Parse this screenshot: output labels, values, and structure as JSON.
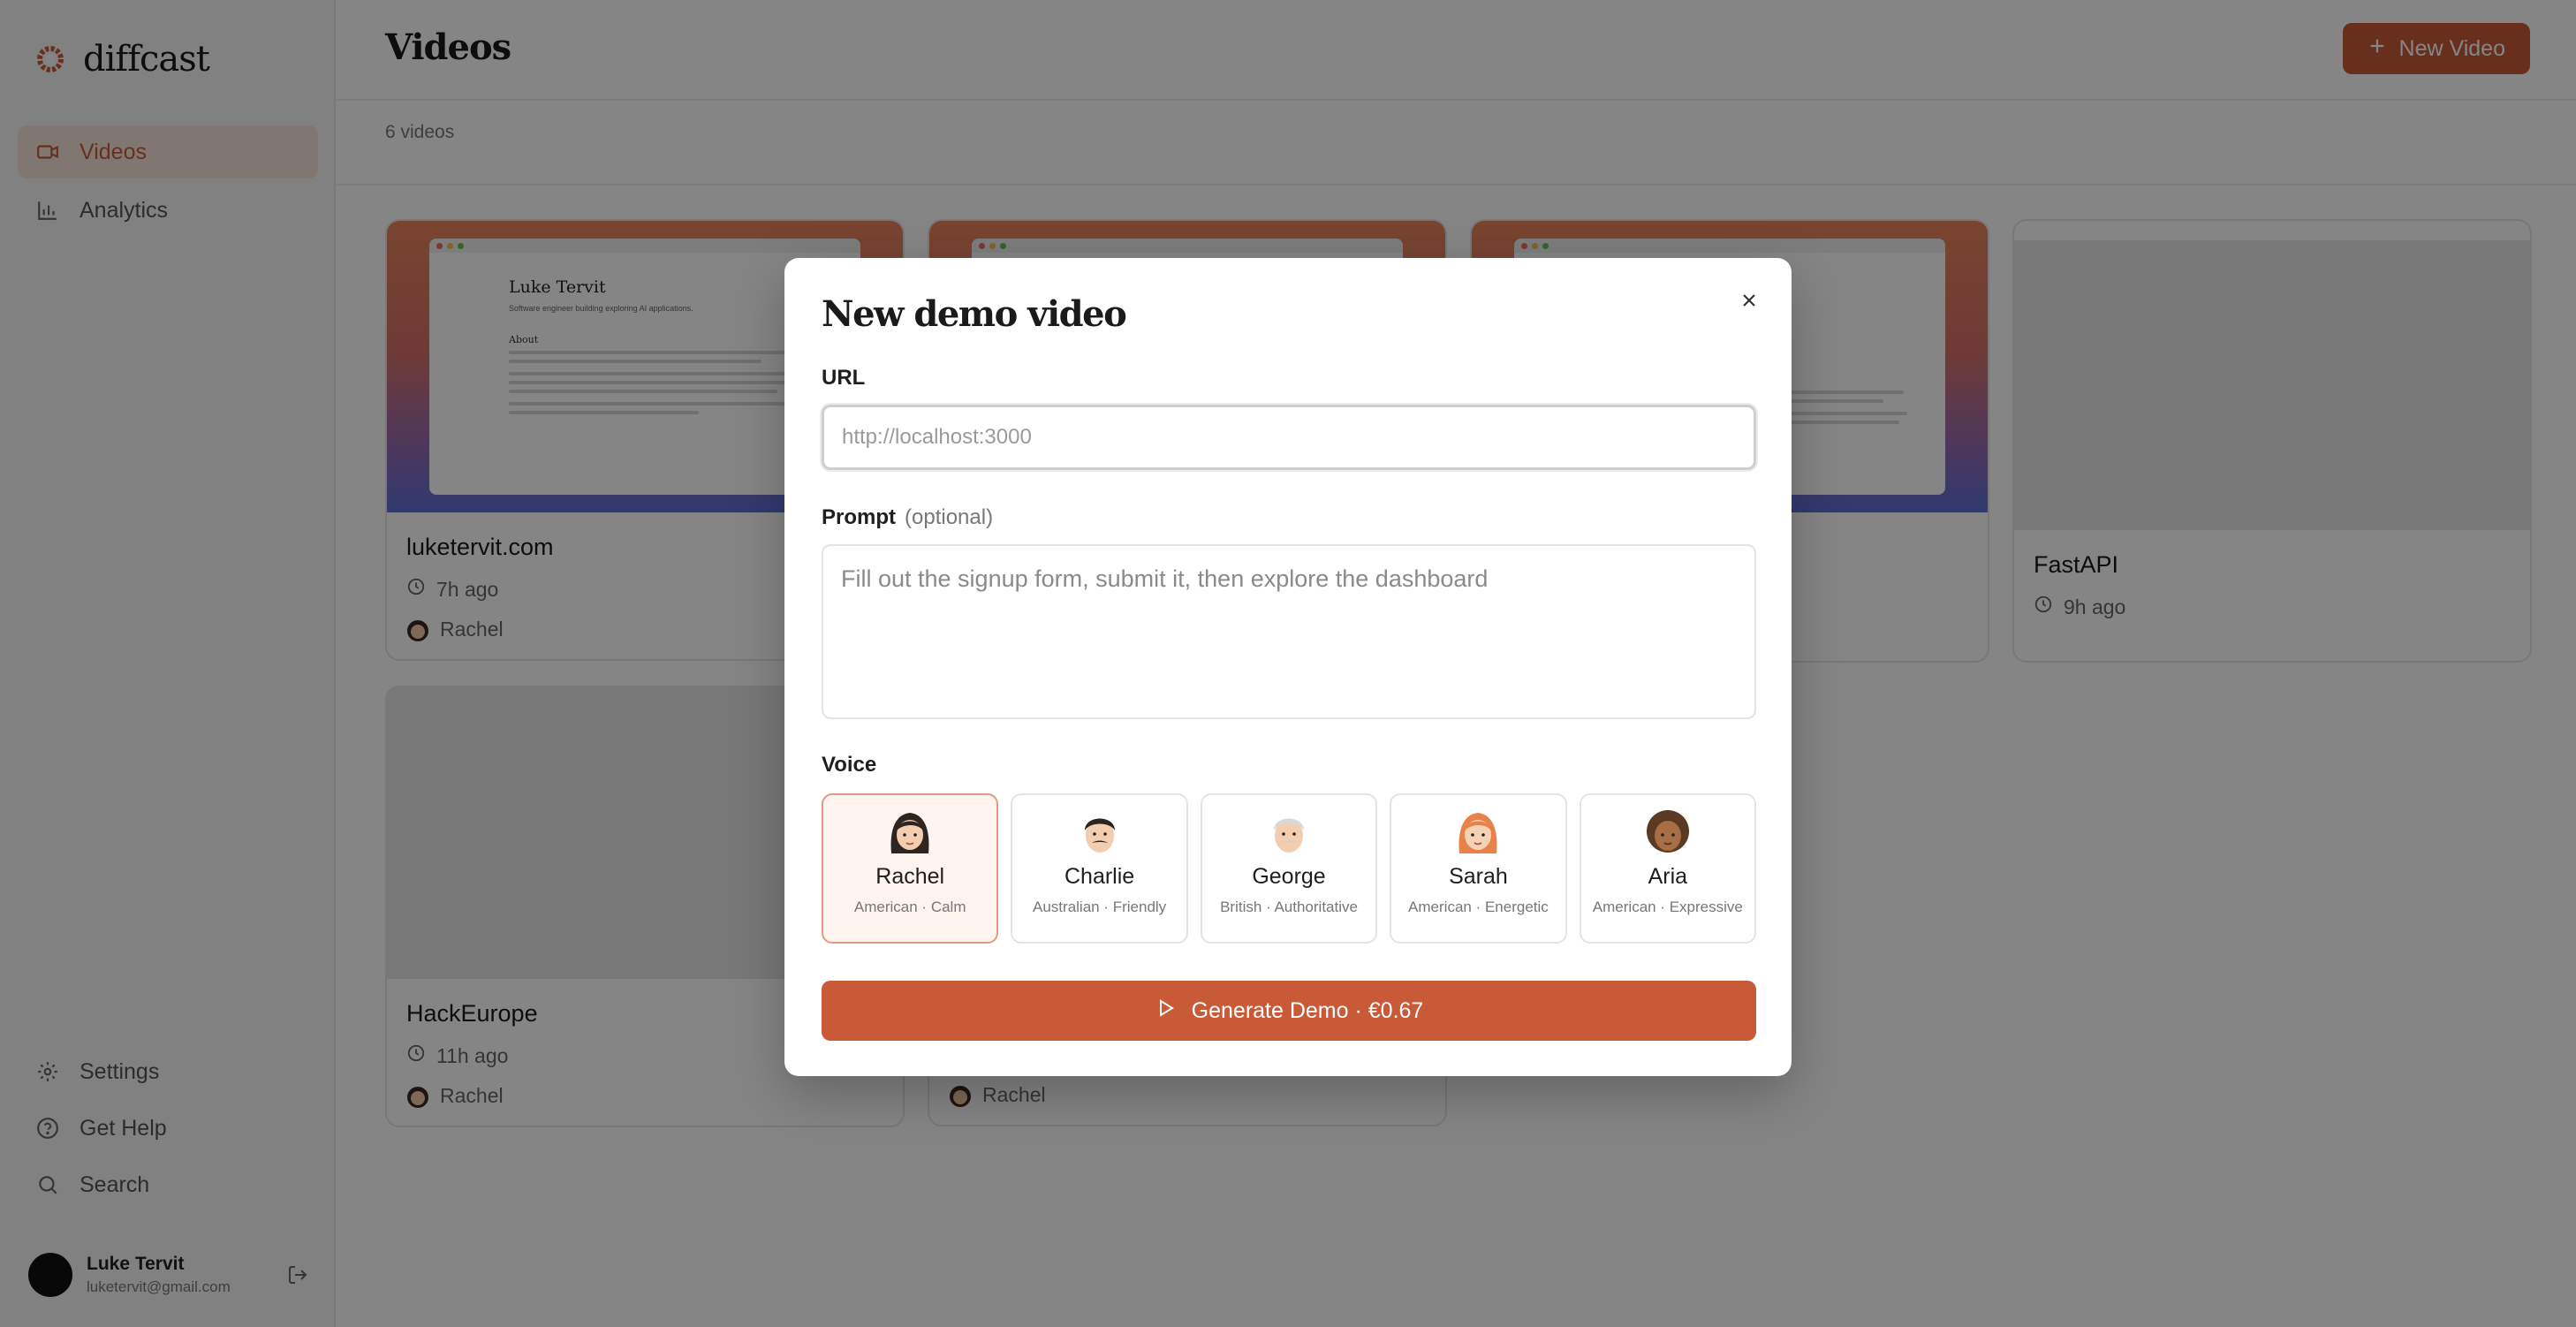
{
  "app": {
    "name": "diffcast"
  },
  "nav": {
    "items": [
      {
        "label": "Videos",
        "icon": "video-icon",
        "active": true
      },
      {
        "label": "Analytics",
        "icon": "bar-chart-icon",
        "active": false
      }
    ],
    "bottom": [
      {
        "label": "Settings",
        "icon": "gear-icon"
      },
      {
        "label": "Get Help",
        "icon": "help-circle-icon"
      },
      {
        "label": "Search",
        "icon": "search-icon"
      }
    ]
  },
  "user": {
    "name": "Luke Tervit",
    "email": "luketervit@gmail.com"
  },
  "header": {
    "title": "Videos",
    "new_button": "New Video",
    "count": "6 videos"
  },
  "videos": [
    {
      "title": "luketervit.com",
      "time": "7h ago",
      "voice": "Rachel"
    },
    {
      "title": "FastAPI",
      "time": "9h ago"
    },
    {
      "title": "HackEurope",
      "time": "11h ago",
      "voice": "Rachel"
    },
    {
      "voice": "Rachel"
    }
  ],
  "preview": {
    "site_title": "Luke Tervit",
    "site_subtitle": "Software engineer building exploring AI applications.",
    "section": "About"
  },
  "modal": {
    "title": "New demo video",
    "url_label": "URL",
    "url_placeholder": "http://localhost:3000",
    "prompt_label": "Prompt",
    "prompt_optional": "(optional)",
    "prompt_placeholder": "Fill out the signup form, submit it, then explore the dashboard",
    "voice_label": "Voice",
    "voices": [
      {
        "name": "Rachel",
        "desc": "American · Calm",
        "selected": true
      },
      {
        "name": "Charlie",
        "desc": "Australian · Friendly",
        "selected": false
      },
      {
        "name": "George",
        "desc": "British · Authoritative",
        "selected": false
      },
      {
        "name": "Sarah",
        "desc": "American · Energetic",
        "selected": false
      },
      {
        "name": "Aria",
        "desc": "American · Expressive",
        "selected": false
      }
    ],
    "generate_label": "Generate Demo · €0.67"
  },
  "colors": {
    "accent": "#c85a37",
    "accent_soft": "#f6e5dd",
    "overlay": "rgba(0,0,0,0.48)"
  }
}
